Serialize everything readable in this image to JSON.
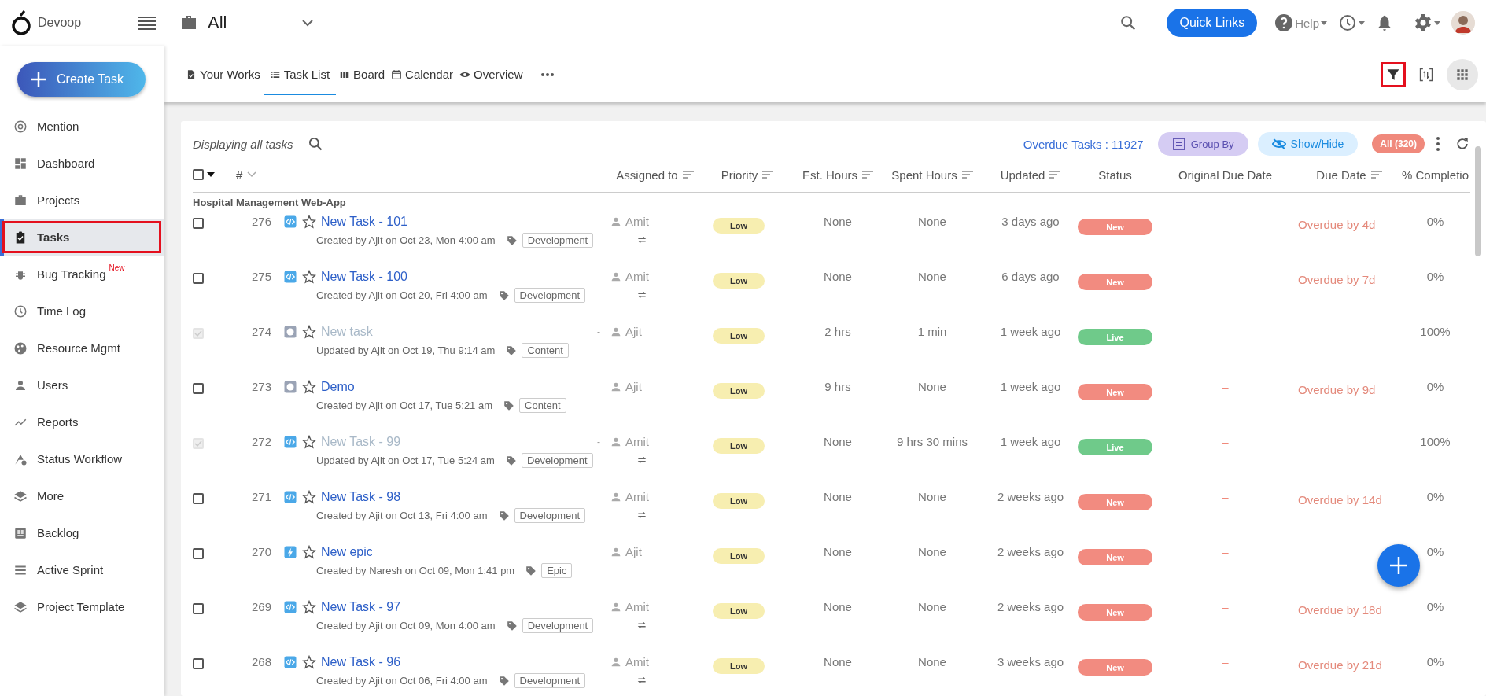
{
  "app": {
    "name": "Devoop"
  },
  "project_picker": {
    "label": "All"
  },
  "header": {
    "quick_links": "Quick Links",
    "help": "Help"
  },
  "create_button": "Create Task",
  "sidebar": {
    "items": [
      {
        "label": "Mention",
        "selected": false,
        "highlighted": false
      },
      {
        "label": "Dashboard",
        "selected": false,
        "highlighted": false
      },
      {
        "label": "Projects",
        "selected": false,
        "highlighted": false
      },
      {
        "label": "Tasks",
        "selected": true,
        "highlighted": true
      },
      {
        "label": "Bug Tracking",
        "badge": "New",
        "selected": false,
        "highlighted": false
      },
      {
        "label": "Time Log",
        "selected": false,
        "highlighted": false
      },
      {
        "label": "Resource Mgmt",
        "selected": false,
        "highlighted": false
      },
      {
        "label": "Users",
        "selected": false,
        "highlighted": false
      },
      {
        "label": "Reports",
        "selected": false,
        "highlighted": false
      },
      {
        "label": "Status Workflow",
        "selected": false,
        "highlighted": false
      },
      {
        "label": "More",
        "selected": false,
        "highlighted": false
      },
      {
        "label": "Backlog",
        "selected": false,
        "highlighted": false
      },
      {
        "label": "Active Sprint",
        "selected": false,
        "highlighted": false
      },
      {
        "label": "Project Template",
        "selected": false,
        "highlighted": false
      }
    ]
  },
  "tabs": [
    {
      "label": "Your Works",
      "selected": false
    },
    {
      "label": "Task List",
      "selected": true
    },
    {
      "label": "Board",
      "selected": false
    },
    {
      "label": "Calendar",
      "selected": false
    },
    {
      "label": "Overview",
      "selected": false
    }
  ],
  "view_tools": [
    {
      "kind": "filter",
      "highlighted": true
    },
    {
      "kind": "swap",
      "highlighted": false
    },
    {
      "kind": "apps",
      "highlighted": false
    }
  ],
  "list": {
    "caption": "Displaying all tasks",
    "overdue": "Overdue Tasks : 11927",
    "group_by": "Group By",
    "show_hide": "Show/Hide",
    "all_count": "All (320)"
  },
  "table": {
    "select_all": {
      "checked": false
    },
    "columns": [
      {
        "label": "#",
        "kind": "chevron"
      },
      {
        "label": "Assigned to",
        "kind": "sort"
      },
      {
        "label": "Priority",
        "kind": "sort"
      },
      {
        "label": "Est. Hours",
        "kind": "sort"
      },
      {
        "label": "Spent Hours",
        "kind": "sort"
      },
      {
        "label": "Updated",
        "kind": "sort"
      },
      {
        "label": "Status",
        "kind": "plain"
      },
      {
        "label": "Original Due Date",
        "kind": "plain"
      },
      {
        "label": "Due Date",
        "kind": "sort"
      },
      {
        "label": "% Completio",
        "kind": "plain"
      }
    ],
    "group": "Hospital Management Web-App",
    "rows": [
      {
        "id": "276",
        "kind": "code",
        "title": "New Task - 101",
        "meta": "Created by Ajit on Oct 23, Mon 4:00 am",
        "tag": "Development",
        "assignee": "Amit",
        "recurring": true,
        "done": false,
        "priority": "Low",
        "est": "None",
        "spent": "None",
        "updated": "3 days ago",
        "status": "New",
        "color": "#f28b80",
        "original_due": "–",
        "due": "Overdue by 4d",
        "completion": "0%"
      },
      {
        "id": "275",
        "kind": "code",
        "title": "New Task - 100",
        "meta": "Created by Ajit on Oct 20, Fri 4:00 am",
        "tag": "Development",
        "assignee": "Amit",
        "recurring": true,
        "done": false,
        "priority": "Low",
        "est": "None",
        "spent": "None",
        "updated": "6 days ago",
        "status": "New",
        "color": "#f28b80",
        "original_due": "–",
        "due": "Overdue by 7d",
        "completion": "0%"
      },
      {
        "id": "274",
        "kind": "circle",
        "title": "New task",
        "meta": "Updated by Ajit on Oct 19, Thu 9:14 am",
        "tag": "Content",
        "dash": "-",
        "assignee": "Ajit",
        "recurring": false,
        "done": true,
        "priority": "Low",
        "est": "2 hrs",
        "spent": "1 min",
        "updated": "1 week ago",
        "status": "Live",
        "color": "#6fca8a",
        "original_due": "–",
        "completion": "100%"
      },
      {
        "id": "273",
        "kind": "circle",
        "title": "Demo",
        "meta": "Created by Ajit on Oct 17, Tue 5:21 am",
        "tag": "Content",
        "assignee": "Ajit",
        "recurring": false,
        "done": false,
        "priority": "Low",
        "est": "9 hrs",
        "spent": "None",
        "updated": "1 week ago",
        "status": "New",
        "color": "#f28b80",
        "original_due": "–",
        "due": "Overdue by 9d",
        "completion": "0%"
      },
      {
        "id": "272",
        "kind": "code",
        "title": "New Task - 99",
        "meta": "Updated by Ajit on Oct 17, Tue 5:24 am",
        "tag": "Development",
        "dash": "-",
        "assignee": "Amit",
        "recurring": true,
        "done": true,
        "priority": "Low",
        "est": "None",
        "spent": "9 hrs 30 mins",
        "updated": "1 week ago",
        "status": "Live",
        "color": "#6fca8a",
        "original_due": "–",
        "completion": "100%"
      },
      {
        "id": "271",
        "kind": "code",
        "title": "New Task - 98",
        "meta": "Created by Ajit on Oct 13, Fri 4:00 am",
        "tag": "Development",
        "assignee": "Amit",
        "recurring": true,
        "done": false,
        "priority": "Low",
        "est": "None",
        "spent": "None",
        "updated": "2 weeks ago",
        "status": "New",
        "color": "#f28b80",
        "original_due": "–",
        "due": "Overdue by 14d",
        "completion": "0%"
      },
      {
        "id": "270",
        "kind": "epic",
        "title": "New epic",
        "meta": "Created by Naresh on Oct 09, Mon 1:41 pm",
        "tag": "Epic",
        "assignee": "Ajit",
        "recurring": false,
        "done": false,
        "priority": "Low",
        "est": "None",
        "spent": "None",
        "updated": "2 weeks ago",
        "status": "New",
        "color": "#f28b80",
        "original_due": "–",
        "completion": "0%"
      },
      {
        "id": "269",
        "kind": "code",
        "title": "New Task - 97",
        "meta": "Created by Ajit on Oct 09, Mon 4:00 am",
        "tag": "Development",
        "assignee": "Amit",
        "recurring": true,
        "done": false,
        "priority": "Low",
        "est": "None",
        "spent": "None",
        "updated": "2 weeks ago",
        "status": "New",
        "color": "#f28b80",
        "original_due": "–",
        "due": "Overdue by 18d",
        "completion": "0%"
      },
      {
        "id": "268",
        "kind": "code",
        "title": "New Task - 96",
        "meta": "Created by Ajit on Oct 06, Fri 4:00 am",
        "tag": "Development",
        "assignee": "Amit",
        "recurring": true,
        "done": false,
        "priority": "Low",
        "est": "None",
        "spent": "None",
        "updated": "3 weeks ago",
        "status": "New",
        "color": "#f28b80",
        "original_due": "–",
        "due": "Overdue by 21d",
        "completion": "0%"
      }
    ]
  }
}
